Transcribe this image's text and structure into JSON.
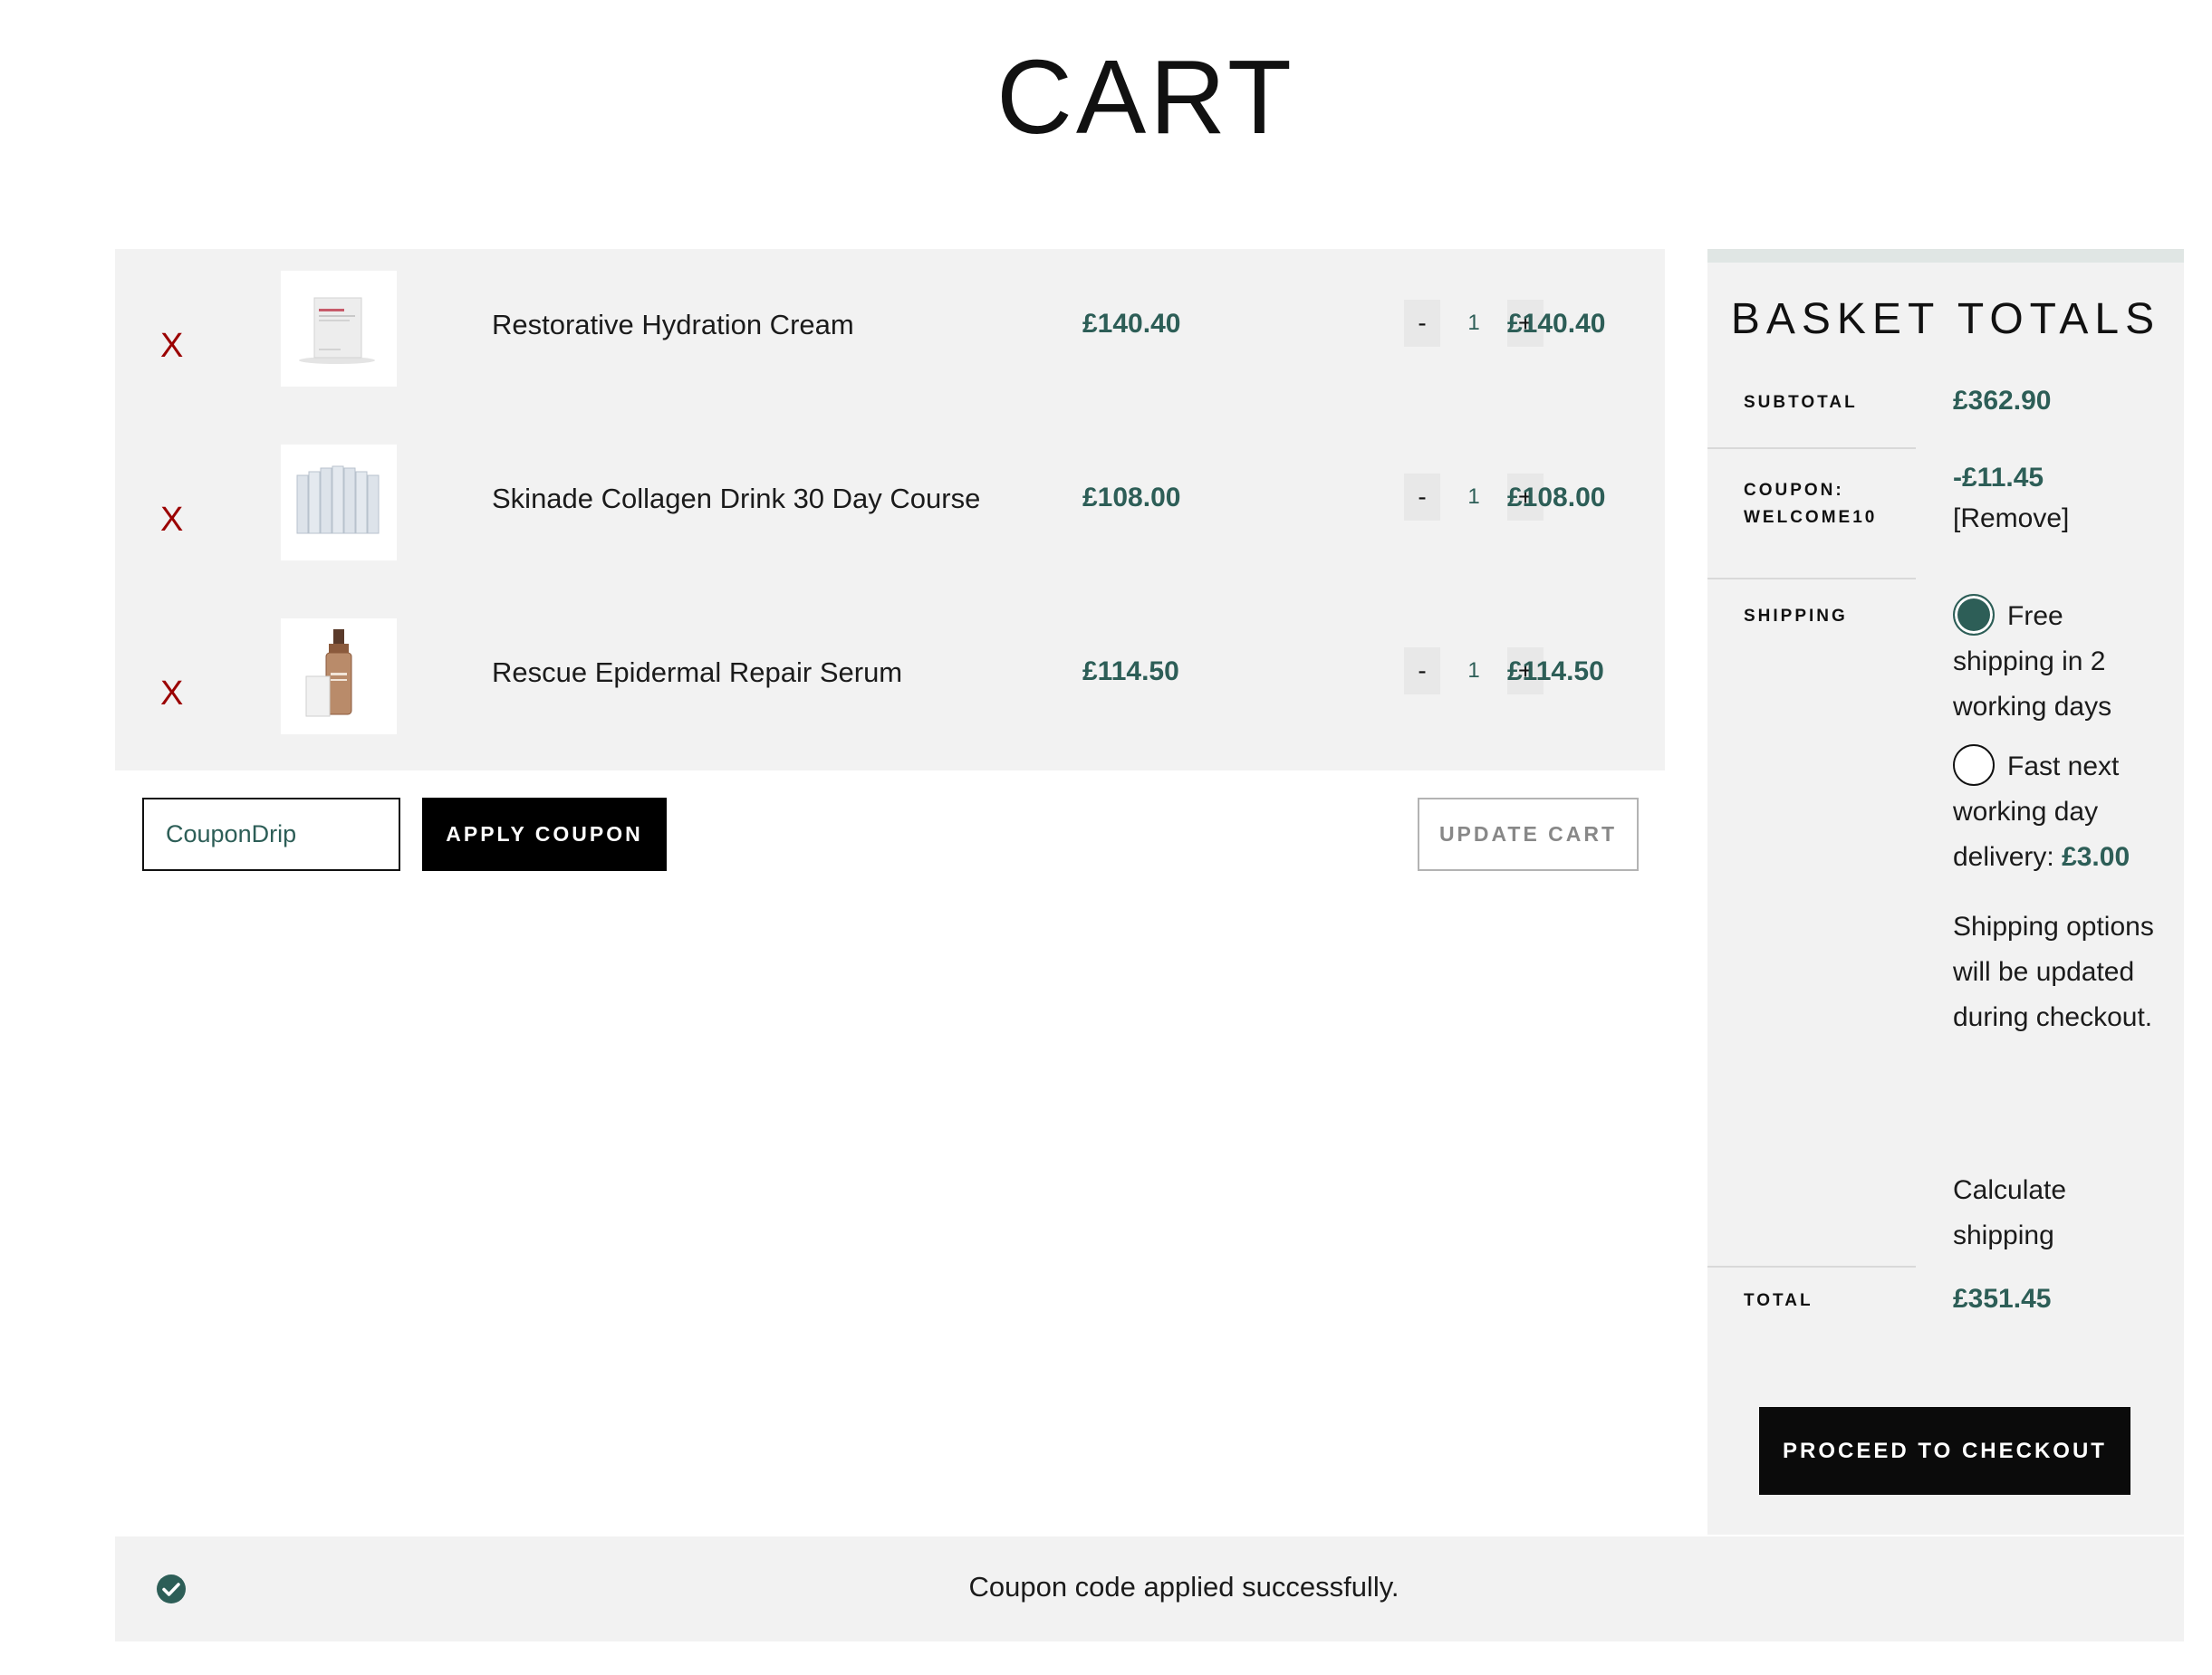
{
  "page": {
    "title": "CART"
  },
  "cart": {
    "items": [
      {
        "remove_icon": "X",
        "name": "Restorative Hydration Cream",
        "price": "£140.40",
        "qty": "1",
        "minus": "-",
        "plus": "+",
        "subtotal": "£140.40"
      },
      {
        "remove_icon": "X",
        "name": "Skinade Collagen Drink 30 Day Course",
        "price": "£108.00",
        "qty": "1",
        "minus": "-",
        "plus": "+",
        "subtotal": "£108.00"
      },
      {
        "remove_icon": "X",
        "name": "Rescue Epidermal Repair Serum",
        "price": "£114.50",
        "qty": "1",
        "minus": "-",
        "plus": "+",
        "subtotal": "£114.50"
      }
    ],
    "coupon": {
      "value": "CouponDrip"
    },
    "apply_label": "APPLY COUPON",
    "update_label": "UPDATE CART"
  },
  "totals": {
    "title": "BASKET TOTALS",
    "subtotal_label": "SUBTOTAL",
    "subtotal_value": "£362.90",
    "coupon_label_line1": "COUPON:",
    "coupon_label_line2": "WELCOME10",
    "coupon_value": "-£11.45",
    "coupon_remove": "[Remove]",
    "shipping_label": "SHIPPING",
    "shipping_options": [
      {
        "label": "Free shipping in 2 working days",
        "price": "",
        "selected": true
      },
      {
        "label": "Fast next working day delivery:",
        "price": "£3.00",
        "selected": false
      }
    ],
    "shipping_note": "Shipping options will be updated during checkout.",
    "calculate_shipping": "Calculate shipping",
    "total_label": "TOTAL",
    "total_value": "£351.45",
    "checkout_label": "PROCEED TO CHECKOUT"
  },
  "notice": {
    "text": "Coupon code applied successfully.",
    "icon": "check-circle-icon"
  },
  "colors": {
    "accent": "#2d5e57",
    "remove": "#9b0000",
    "panel": "#f2f2f2",
    "button": "#000000"
  }
}
